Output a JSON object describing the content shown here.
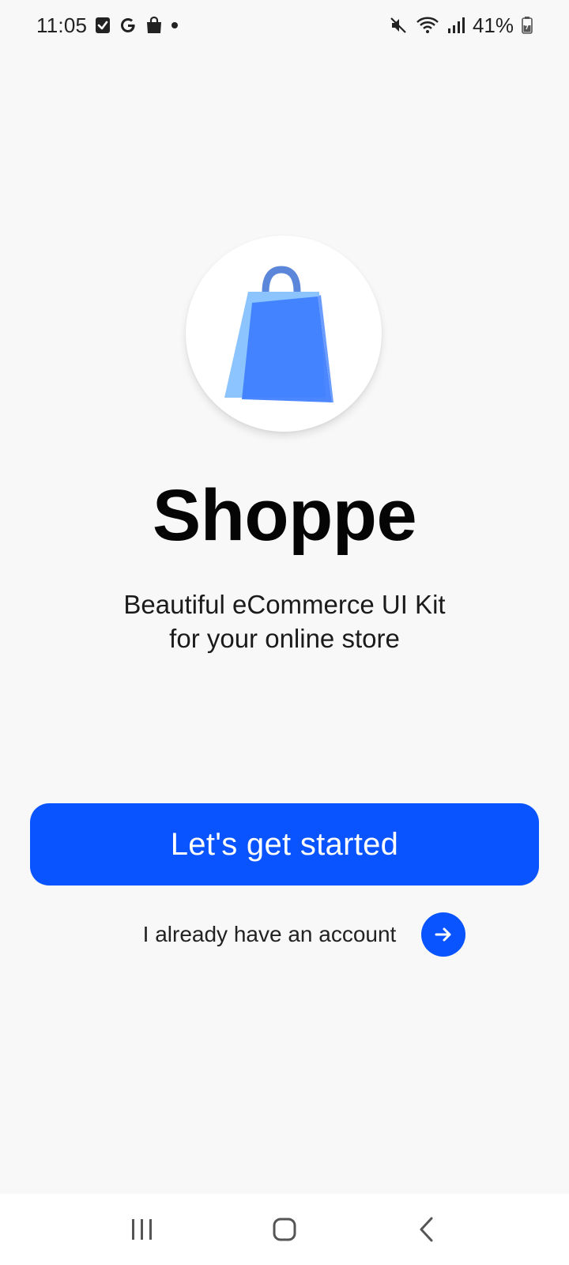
{
  "status_bar": {
    "time": "11:05",
    "battery": "41%",
    "left_icons": [
      "checkbox-icon",
      "google-icon",
      "shopping-bag-icon",
      "dot-icon"
    ],
    "right_icons": [
      "mute-icon",
      "wifi-icon",
      "signal-icon",
      "battery-icon"
    ]
  },
  "app": {
    "name": "Shoppe",
    "tagline_line1": "Beautiful eCommerce UI Kit",
    "tagline_line2": "for your online store",
    "logo_icon": "shopping-bag-icon"
  },
  "actions": {
    "get_started_label": "Let's get started",
    "have_account_label": "I already have an account",
    "arrow_icon": "arrow-right-icon"
  },
  "navigation": {
    "items": [
      "recent-apps-icon",
      "home-icon",
      "back-icon"
    ]
  },
  "colors": {
    "accent": "#0a54ff",
    "background": "#f8f8f8",
    "bag_light": "#8cc4ff",
    "bag_dark": "#3d7dff",
    "bag_handle": "#5b86d9"
  }
}
